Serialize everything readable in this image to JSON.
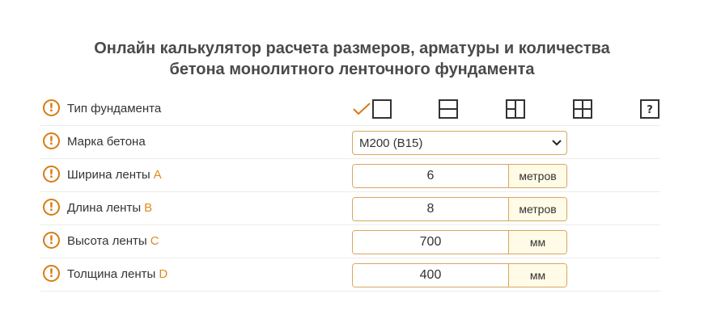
{
  "title": {
    "line1": "Онлайн калькулятор расчета размеров, арматуры и количества",
    "line2": "бетона монолитного ленточного фундамента"
  },
  "colors": {
    "accent": "#d77c12",
    "border": "#d9a65f",
    "unit_bg": "#fffbe6"
  },
  "rows": {
    "type": {
      "label": "Тип фундамента",
      "options": [
        "single-box-icon",
        "horizontal-split-icon",
        "cross-half-icon",
        "four-cell-grid-icon",
        "question-box-icon"
      ],
      "selected_index": 0,
      "question_glyph": "?"
    },
    "grade": {
      "label": "Марка бетона",
      "value": "М200 (B15)"
    },
    "width": {
      "label": "Ширина ленты",
      "letter": "A",
      "value": "6",
      "unit": "метров"
    },
    "length": {
      "label": "Длина ленты",
      "letter": "B",
      "value": "8",
      "unit": "метров"
    },
    "height": {
      "label": "Высота ленты",
      "letter": "C",
      "value": "700",
      "unit": "мм"
    },
    "thickness": {
      "label": "Толщина ленты",
      "letter": "D",
      "value": "400",
      "unit": "мм"
    }
  },
  "help_glyph": "!"
}
